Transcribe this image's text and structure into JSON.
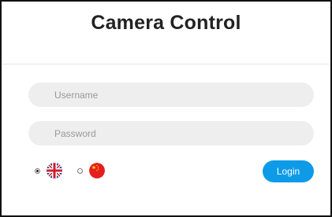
{
  "header": {
    "title": "Camera Control"
  },
  "form": {
    "username_placeholder": "Username",
    "password_placeholder": "Password",
    "login_label": "Login"
  },
  "language": {
    "options": [
      {
        "flag": "uk-flag-icon",
        "selected": true
      },
      {
        "flag": "china-flag-icon",
        "selected": false
      }
    ]
  },
  "colors": {
    "accent": "#0d9be8",
    "field_background": "#eeeeee"
  }
}
